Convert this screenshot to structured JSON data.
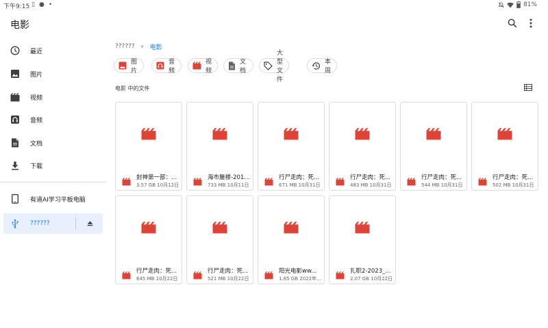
{
  "status_bar": {
    "time": "下午9:15",
    "battery": "81%"
  },
  "app_bar": {
    "title": "电影"
  },
  "sidebar": {
    "items": [
      {
        "label": "最近",
        "icon": "clock-icon"
      },
      {
        "label": "图片",
        "icon": "image-icon"
      },
      {
        "label": "视频",
        "icon": "video-icon"
      },
      {
        "label": "音频",
        "icon": "audio-icon"
      },
      {
        "label": "文档",
        "icon": "document-icon"
      },
      {
        "label": "下载",
        "icon": "download-icon"
      }
    ],
    "devices": [
      {
        "label": "有道AI学习平板电脑",
        "icon": "tablet-icon"
      },
      {
        "label": "??????",
        "icon": "usb-icon",
        "selected": true
      }
    ]
  },
  "breadcrumb": {
    "root": "??????",
    "separator": "›",
    "current": "电影"
  },
  "chips": [
    {
      "label": "图片",
      "icon": "image-icon"
    },
    {
      "label": "音频",
      "icon": "audio-icon"
    },
    {
      "label": "视频",
      "icon": "video-icon"
    },
    {
      "label": "文档",
      "icon": "document-icon"
    },
    {
      "label": "大型文件",
      "icon": "tag-icon"
    },
    {
      "label": "本周",
      "icon": "history-icon"
    }
  ],
  "section": {
    "title": "电影 中的文件"
  },
  "files": [
    {
      "name": "封神第一部：...",
      "meta": "3.57 GB 10月12日"
    },
    {
      "name": "海市蜃楼-201...",
      "meta": "733 MB 10月11日"
    },
    {
      "name": "行尸走肉：死...",
      "meta": "671 MB 10月31日"
    },
    {
      "name": "行尸走肉：死...",
      "meta": "483 MB 10月31日"
    },
    {
      "name": "行尸走肉：死...",
      "meta": "544 MB 10月31日"
    },
    {
      "name": "行尸走肉：死...",
      "meta": "502 MB 10月31日"
    },
    {
      "name": "行尸走肉：死...",
      "meta": "645 MB 10月22日"
    },
    {
      "name": "行尸走肉：死...",
      "meta": "521 MB 10月22日"
    },
    {
      "name": "阳光电影ww...",
      "meta": "1.85 GB 2022年..."
    },
    {
      "name": "扎职2-2023_...",
      "meta": "2.07 GB 10月22日"
    }
  ],
  "colors": {
    "accent": "#1a73e8",
    "video_red": "#db4437",
    "selected_bg": "#e8f0fe",
    "border": "#dadce0"
  }
}
